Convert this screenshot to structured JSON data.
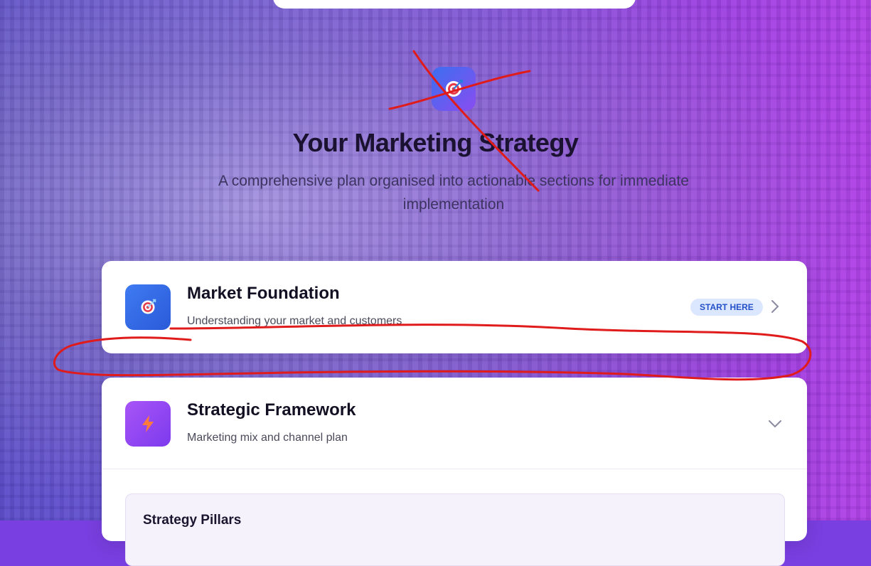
{
  "hero": {
    "icon": "target-icon",
    "title": "Your Marketing Strategy",
    "subtitle": "A comprehensive plan organised into actionable sections for immediate implementation"
  },
  "sections": [
    {
      "icon": "target-icon",
      "title": "Market Foundation",
      "description": "Understanding your market and customers",
      "badge": "START HERE",
      "state": "collapsed"
    },
    {
      "icon": "lightning-icon",
      "title": "Strategic Framework",
      "description": "Marketing mix and channel plan",
      "state": "expanded",
      "content": {
        "pillars_title": "Strategy Pillars"
      }
    }
  ],
  "colors": {
    "accent_blue": "#3f7bf2",
    "accent_purple": "#8b5cf6",
    "badge_bg": "#dbe7ff",
    "annotation_red": "#e01b1b"
  }
}
